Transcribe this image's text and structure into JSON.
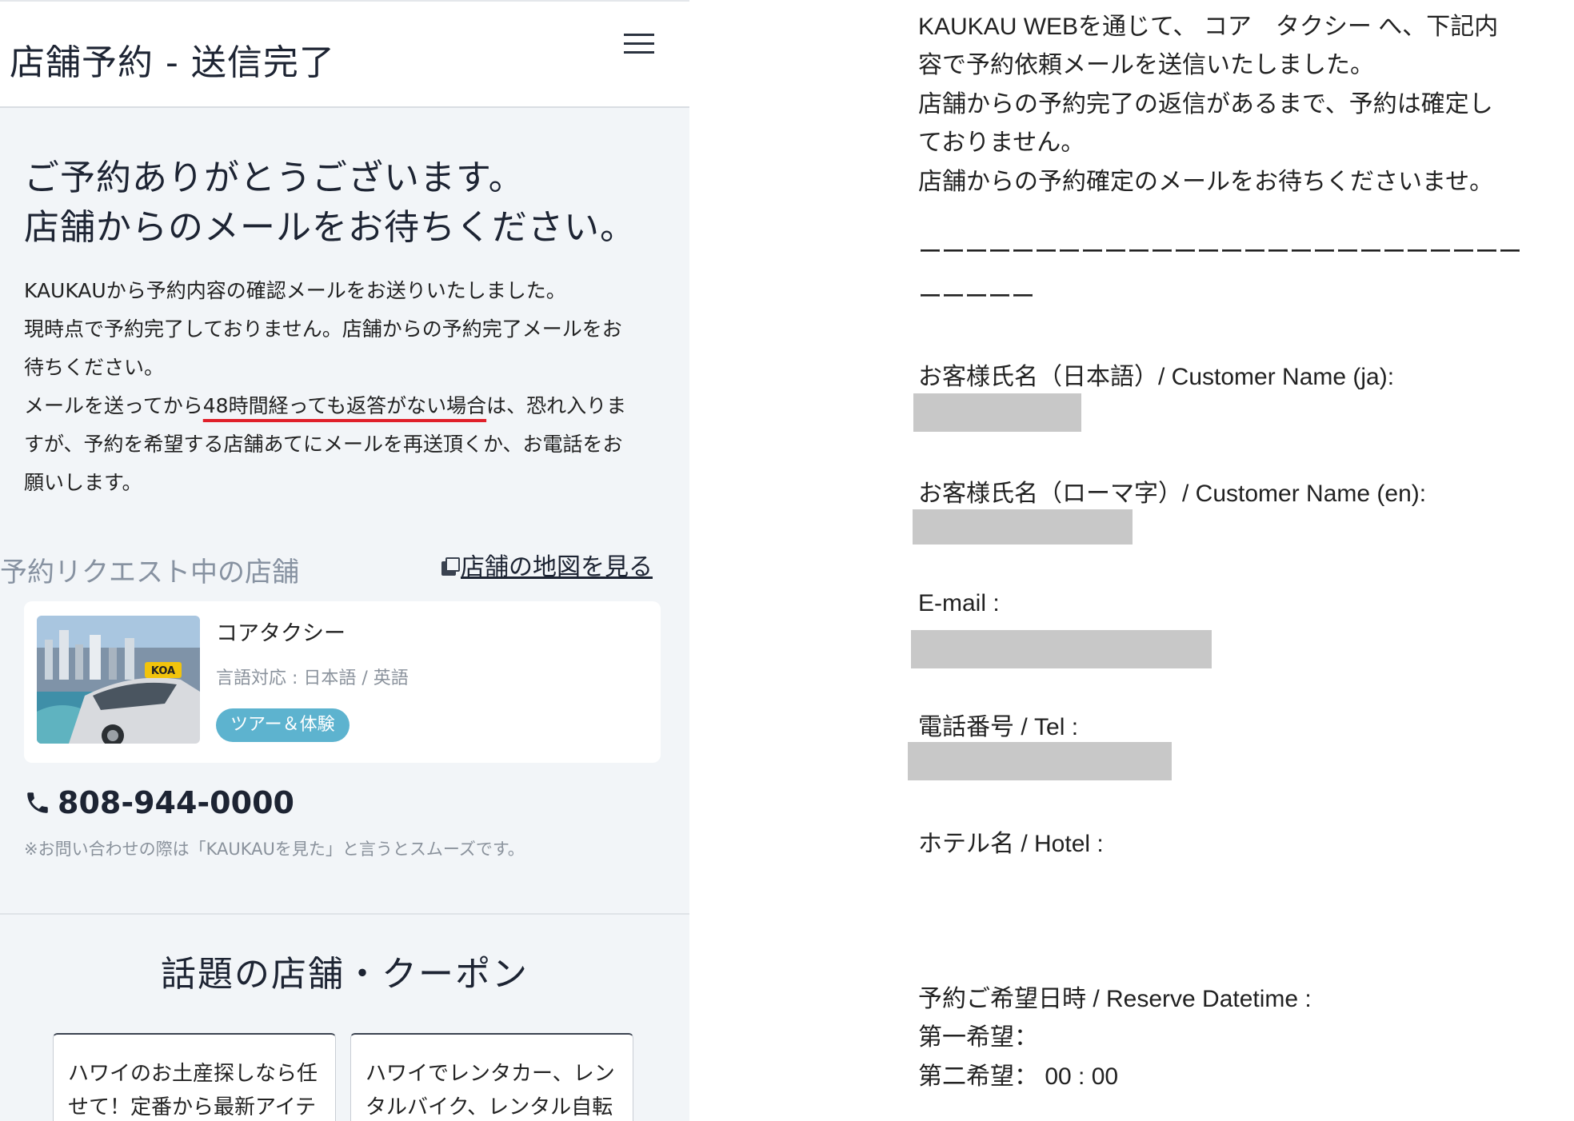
{
  "header": {
    "title": "店舗予約 - 送信完了",
    "menu_icon": "hamburger-menu-icon"
  },
  "confirmation": {
    "heading_line1": "ご予約ありがとうございます。",
    "heading_line2": "店舗からのメールをお待ちください。",
    "notice_line1": "KAUKAUから予約内容の確認メールをお送りいたしました。",
    "notice_line2": "現時点で予約完了しておりません。店舗からの予約完了メールをお",
    "notice_line3": "待ちください。",
    "notice_line4_pre": "メールを送ってから",
    "notice_line4_highlight": "48時間経っても返答がない場合",
    "notice_line4_post": "は、恐れ入りま",
    "notice_line5": "すが、予約を希望する店舗あてにメールを再送頂くか、お電話をお",
    "notice_line6": "願いします。",
    "highlight_color": "#e0202a"
  },
  "shop_section": {
    "title": "予約リクエスト中の店舗",
    "map_link": "店舗の地図を見る",
    "shop": {
      "name": "コアタクシー",
      "languages": "言語対応 : 日本語 / 英語",
      "tag": "ツアー＆体験",
      "tag_color": "#5db3cf",
      "image_label": "KOA"
    },
    "phone": "808-944-0000",
    "phone_note": "※お問い合わせの際は「KAUKAUを見た」と言うとスムーズです。"
  },
  "popular": {
    "title": "話題の店舗・クーポン",
    "cards": [
      {
        "line1": "ハワイのお土産探しなら任",
        "line2": "せて！定番から最新アイテ"
      },
      {
        "line1": "ハワイでレンタカー、レン",
        "line2": "タルバイク、レンタル自転"
      }
    ]
  },
  "email": {
    "intro_line1": "KAUKAU WEBを通じて、 コア　タクシー へ、下記内",
    "intro_line2": "容で予約依頼メールを送信いたしました。",
    "intro_line3": "店舗からの予約完了の返信があるまで、予約は確定し",
    "intro_line4": "ておりません。",
    "intro_line5": "店舗からの予約確定のメールをお待ちくださいませ。",
    "separator": "ーーーーーーーーーーーーーーーーーーーーーーーーーーーーーーー",
    "fields": {
      "name_ja": "お客様氏名（日本語）/ Customer Name (ja):",
      "name_en": "お客様氏名（ローマ字）/ Customer Name (en):",
      "email": "E-mail :",
      "tel": "電話番号 / Tel :",
      "hotel": "ホテル名 / Hotel :",
      "datetime": "予約ご希望日時 / Reserve Datetime :",
      "first_choice": "第一希望：",
      "second_choice": "第二希望：  00 : 00"
    }
  }
}
